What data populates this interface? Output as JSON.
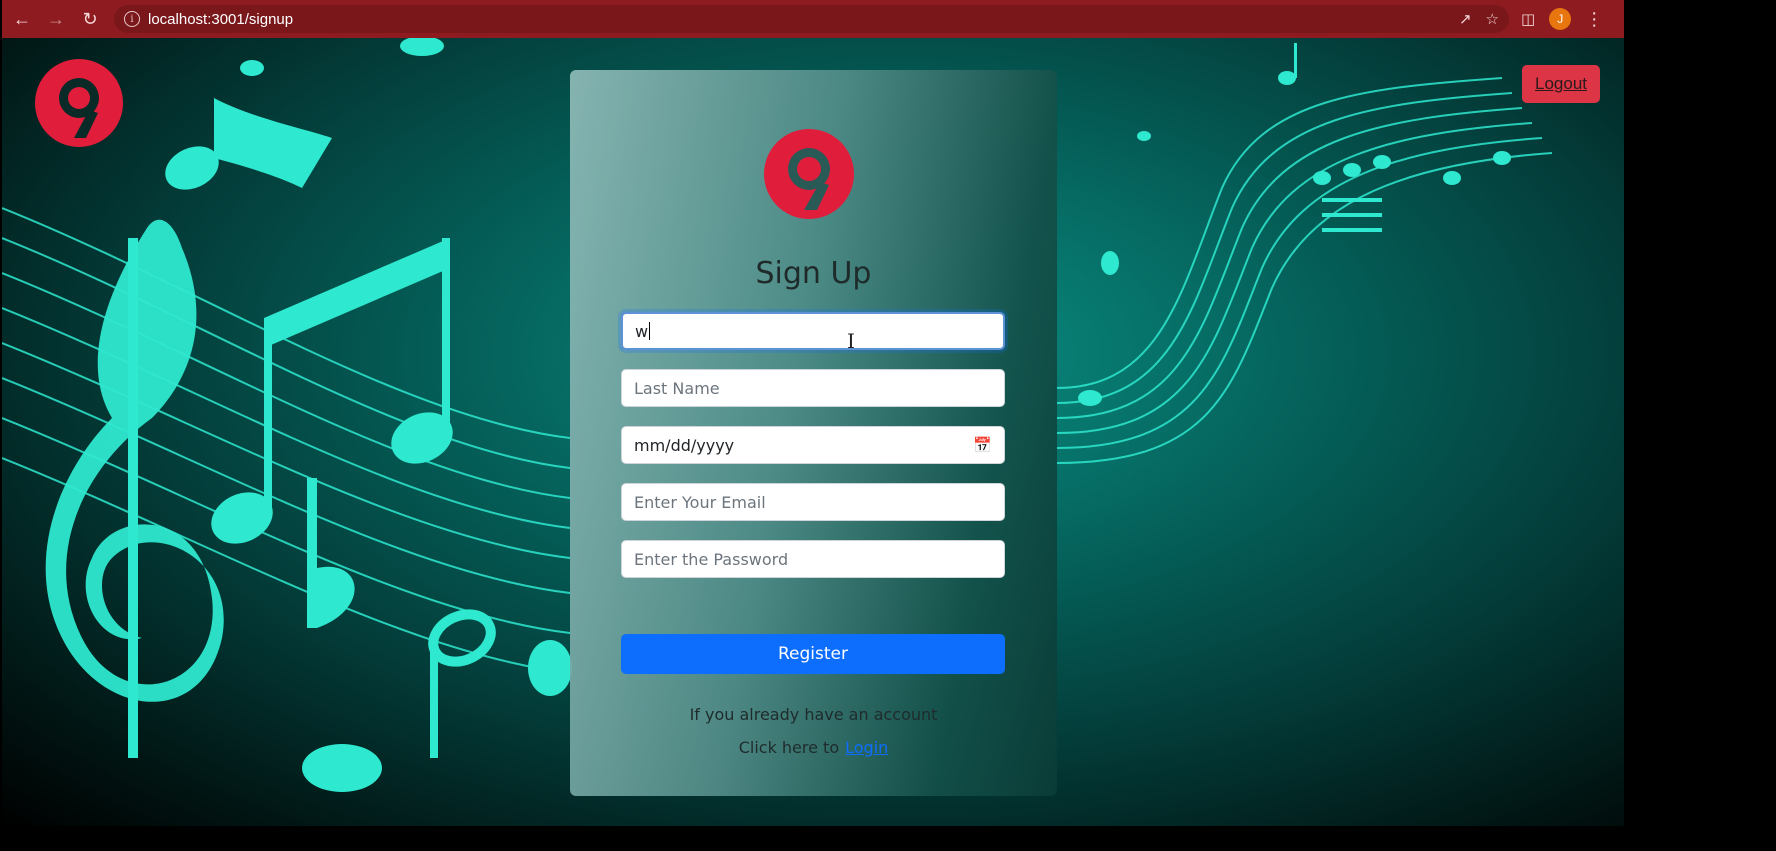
{
  "browser": {
    "url": "localhost:3001/signup",
    "avatar_letter": "J",
    "icons": [
      "back-icon",
      "forward-icon",
      "reload-icon",
      "info-icon",
      "share-icon",
      "star-icon",
      "sidepanel-icon",
      "menu-icon"
    ]
  },
  "header": {
    "logout_label": "Logout"
  },
  "form": {
    "title": "Sign Up",
    "first_name_value": "w",
    "last_name_placeholder": "Last Name",
    "dob_placeholder": "mm/dd/yyyy",
    "email_placeholder": "Enter Your Email",
    "password_placeholder": "Enter the Password",
    "register_label": "Register",
    "note_line1": "If you already have an account",
    "note_line2": "Click here to",
    "login_label": "Login"
  },
  "colors": {
    "chrome": "#8e1b20",
    "accent_red": "#dc3545",
    "primary_blue": "#0d6efd",
    "music_cyan": "#2ee8cf",
    "logo_red": "#e01e3c"
  }
}
